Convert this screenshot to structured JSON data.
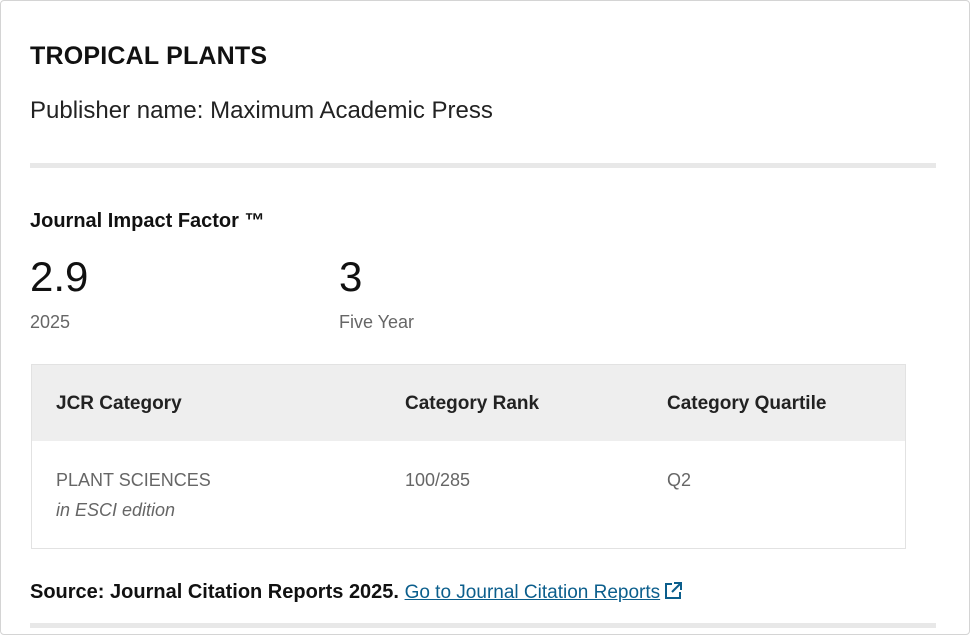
{
  "journal": {
    "title": "TROPICAL PLANTS",
    "publisher": "Publisher name: Maximum Academic Press"
  },
  "impact_factor": {
    "heading": "Journal Impact Factor ™",
    "metrics": [
      {
        "value": "2.9",
        "label": "2025"
      },
      {
        "value": "3",
        "label": "Five Year"
      }
    ]
  },
  "category_table": {
    "headers": [
      "JCR Category",
      "Category Rank",
      "Category Quartile"
    ],
    "rows": [
      {
        "category": "PLANT SCIENCES",
        "edition": "in ESCI edition",
        "rank": "100/285",
        "quartile": "Q2"
      }
    ]
  },
  "source": {
    "prefix": "Source: Journal Citation Reports",
    "year": "2025.",
    "link_label": "Go to Journal Citation Reports",
    "link_icon": "external-link-icon"
  },
  "colors": {
    "link": "#0b5e8c",
    "header_bg": "#eeeeee",
    "muted_text": "#666666"
  }
}
